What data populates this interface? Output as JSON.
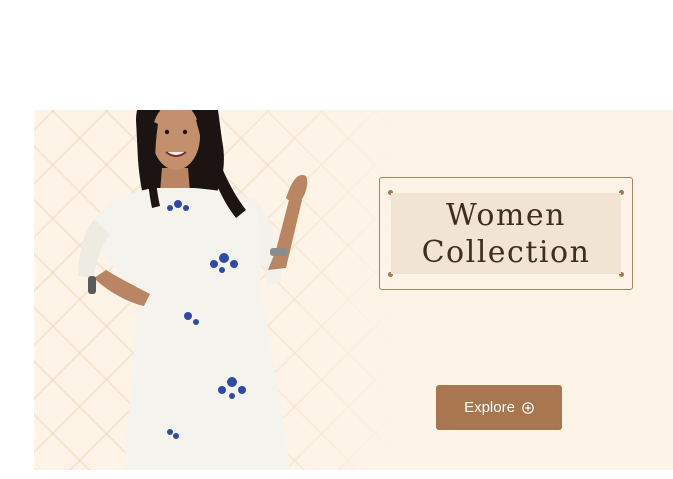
{
  "banner": {
    "title": "Women\nCollection",
    "cta_label": "Explore",
    "cta_icon": "plus-circle-icon",
    "model_image": "woman-in-white-embroidered-kurta",
    "colors": {
      "background": "#fdf3e7",
      "title_box": "#f2e4d2",
      "frame": "#a98463",
      "button": "#a87750",
      "title_text": "#3e2d22"
    }
  }
}
